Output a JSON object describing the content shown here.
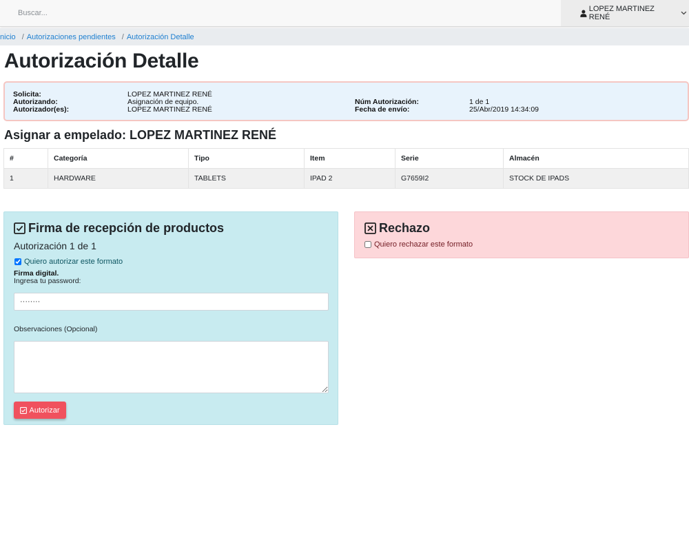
{
  "search": {
    "placeholder": "Buscar..."
  },
  "user": {
    "name": "LOPEZ MARTINEZ RENÉ"
  },
  "breadcrumb": [
    "Inicio",
    "Autorizaciones pendientes",
    "Autorización Detalle"
  ],
  "page_title": "Autorización Detalle",
  "info": {
    "solicita_label": "Solicita:",
    "solicita_value": "LOPEZ MARTINEZ RENÉ",
    "autorizando_label": "Autorizando:",
    "autorizando_value": "Asignación de equipo.",
    "autorizadores_label": "Autorizador(es):",
    "autorizadores_value": "LOPEZ MARTINEZ RENÉ",
    "num_label": "Núm Autorización:",
    "num_value": "1 de 1",
    "fecha_label": "Fecha de envío:",
    "fecha_value": "25/Abr/2019 14:34:09"
  },
  "subheading": "Asignar a empelado: LOPEZ MARTINEZ RENÉ",
  "table": {
    "headers": [
      "#",
      "Categoría",
      "Tipo",
      "Item",
      "Serie",
      "Almacén"
    ],
    "rows": [
      [
        "1",
        "HARDWARE",
        "TABLETS",
        "IPAD 2",
        "G7659I2",
        "STOCK DE IPADS"
      ]
    ]
  },
  "sign_card": {
    "title": "Firma de recepción de productos",
    "subtitle": "Autorización 1 de 1",
    "checkbox_label": "Quiero autorizar este formato",
    "firma_label": "Firma digital.",
    "password_label": "Ingresa tu password:",
    "password_value": "········",
    "obs_label": "Observaciones (Opcional)",
    "button_label": "Autorizar"
  },
  "reject_card": {
    "title": "Rechazo",
    "checkbox_label": "Quiero rechazar este formato"
  }
}
